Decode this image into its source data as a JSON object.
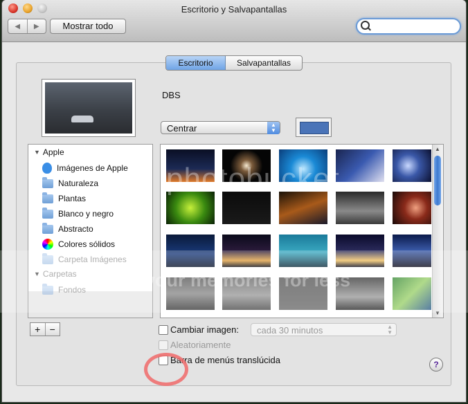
{
  "window": {
    "title": "Escritorio y Salvapantallas"
  },
  "toolbar": {
    "back_label": "◀",
    "forward_label": "▶",
    "show_all_label": "Mostrar todo",
    "search_value": ""
  },
  "tabs": [
    {
      "label": "Escritorio",
      "selected": true
    },
    {
      "label": "Salvapantallas",
      "selected": false
    }
  ],
  "current": {
    "name": "DBS",
    "position_value": "Centrar",
    "color": "#4a74b8"
  },
  "sidebar": {
    "group_apple": "Apple",
    "items_apple": [
      {
        "label": "Imágenes de Apple",
        "icon": "apple-icon"
      },
      {
        "label": "Naturaleza",
        "icon": "folder-icon"
      },
      {
        "label": "Plantas",
        "icon": "folder-icon"
      },
      {
        "label": "Blanco y negro",
        "icon": "folder-icon"
      },
      {
        "label": "Abstracto",
        "icon": "folder-icon"
      },
      {
        "label": "Colores sólidos",
        "icon": "color-wheel-icon"
      },
      {
        "label": "Carpeta Imágenes",
        "icon": "folder-icon",
        "disabled": true
      }
    ],
    "group_carpetas": "Carpetas",
    "items_carpetas": [
      {
        "label": "Fondos",
        "icon": "folder-icon",
        "disabled": true
      }
    ],
    "add_label": "+",
    "remove_label": "−"
  },
  "thumbnails": [
    "city-night",
    "light-trails-dark",
    "water-drop-blue",
    "anime-girl",
    "blue-nebula",
    "green-snake",
    "black-text",
    "highway-night",
    "city-bw",
    "red-abstract",
    "blue-forest",
    "bridge-night",
    "city-skyline-teal",
    "hong-kong-night",
    "mountain-night",
    "city-gray",
    "road-gray",
    "gray-text",
    "girl-bw",
    "green-abstract"
  ],
  "options": {
    "change_image_label": "Cambiar imagen:",
    "change_image_checked": false,
    "interval_value": "cada 30 minutos",
    "random_label": "Aleatoriamente",
    "random_checked": false,
    "translucent_label": "Barra de menús translúcida",
    "translucent_checked": false
  },
  "help_label": "?",
  "watermark": {
    "top": "photobucket",
    "bottom": "ot your memories for less"
  }
}
